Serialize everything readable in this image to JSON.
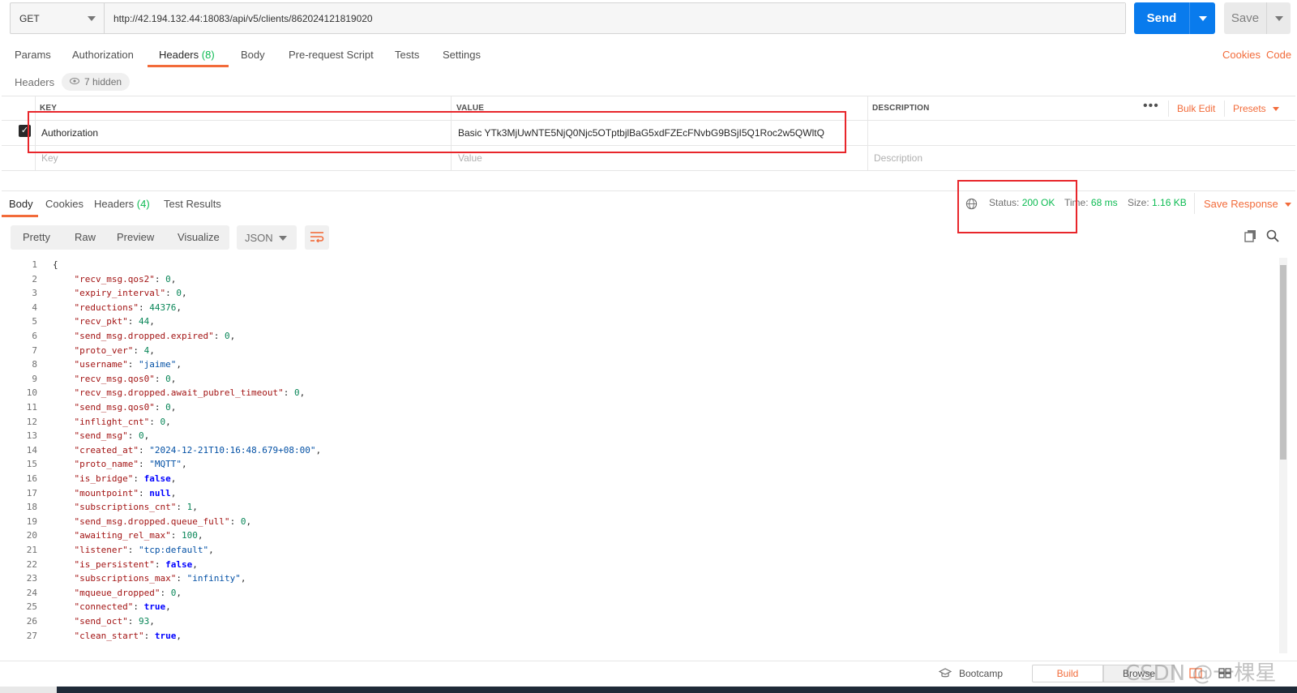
{
  "request": {
    "method": "GET",
    "url": "http://42.194.132.44:18083/api/v5/clients/862024121819020",
    "send_label": "Send",
    "save_label": "Save"
  },
  "request_tabs": [
    {
      "label": "Params"
    },
    {
      "label": "Authorization"
    },
    {
      "label": "Headers",
      "count": "(8)"
    },
    {
      "label": "Body"
    },
    {
      "label": "Pre-request Script"
    },
    {
      "label": "Tests"
    },
    {
      "label": "Settings"
    }
  ],
  "right_links": {
    "cookies": "Cookies",
    "code": "Code"
  },
  "headers_section": {
    "title": "Headers",
    "hidden_badge": "7 hidden",
    "columns": {
      "key": "KEY",
      "value": "VALUE",
      "description": "DESCRIPTION"
    },
    "actions": {
      "bulk_edit": "Bulk Edit",
      "presets": "Presets"
    },
    "rows": [
      {
        "key": "Authorization",
        "value": "Basic YTk3MjUwNTE5NjQ0Njc5OTptbjlBaG5xdFZEcFNvbG9BSjI5Q1Roc2w5QWltQ",
        "description": ""
      }
    ],
    "placeholder": {
      "key": "Key",
      "value": "Value",
      "description": "Description"
    }
  },
  "response_tabs": [
    {
      "label": "Body"
    },
    {
      "label": "Cookies"
    },
    {
      "label": "Headers",
      "count": "(4)"
    },
    {
      "label": "Test Results"
    }
  ],
  "response_status": {
    "status_label": "Status:",
    "status_value": "200 OK",
    "time_label": "Time:",
    "time_value": "68 ms",
    "size_label": "Size:",
    "size_value": "1.16 KB",
    "save_response": "Save Response"
  },
  "view_modes": [
    "Pretty",
    "Raw",
    "Preview",
    "Visualize"
  ],
  "format": "JSON",
  "json_lines": [
    {
      "n": "1",
      "k": "",
      "v": "",
      "t": "open"
    },
    {
      "n": "2",
      "k": "\"recv_msg.qos2\"",
      "v": "0",
      "t": "num"
    },
    {
      "n": "3",
      "k": "\"expiry_interval\"",
      "v": "0",
      "t": "num"
    },
    {
      "n": "4",
      "k": "\"reductions\"",
      "v": "44376",
      "t": "num"
    },
    {
      "n": "5",
      "k": "\"recv_pkt\"",
      "v": "44",
      "t": "num"
    },
    {
      "n": "6",
      "k": "\"send_msg.dropped.expired\"",
      "v": "0",
      "t": "num"
    },
    {
      "n": "7",
      "k": "\"proto_ver\"",
      "v": "4",
      "t": "num"
    },
    {
      "n": "8",
      "k": "\"username\"",
      "v": "\"jaime\"",
      "t": "str"
    },
    {
      "n": "9",
      "k": "\"recv_msg.qos0\"",
      "v": "0",
      "t": "num"
    },
    {
      "n": "10",
      "k": "\"recv_msg.dropped.await_pubrel_timeout\"",
      "v": "0",
      "t": "num"
    },
    {
      "n": "11",
      "k": "\"send_msg.qos0\"",
      "v": "0",
      "t": "num"
    },
    {
      "n": "12",
      "k": "\"inflight_cnt\"",
      "v": "0",
      "t": "num"
    },
    {
      "n": "13",
      "k": "\"send_msg\"",
      "v": "0",
      "t": "num"
    },
    {
      "n": "14",
      "k": "\"created_at\"",
      "v": "\"2024-12-21T10:16:48.679+08:00\"",
      "t": "str"
    },
    {
      "n": "15",
      "k": "\"proto_name\"",
      "v": "\"MQTT\"",
      "t": "str"
    },
    {
      "n": "16",
      "k": "\"is_bridge\"",
      "v": "false",
      "t": "kw"
    },
    {
      "n": "17",
      "k": "\"mountpoint\"",
      "v": "null",
      "t": "kw"
    },
    {
      "n": "18",
      "k": "\"subscriptions_cnt\"",
      "v": "1",
      "t": "num"
    },
    {
      "n": "19",
      "k": "\"send_msg.dropped.queue_full\"",
      "v": "0",
      "t": "num"
    },
    {
      "n": "20",
      "k": "\"awaiting_rel_max\"",
      "v": "100",
      "t": "num"
    },
    {
      "n": "21",
      "k": "\"listener\"",
      "v": "\"tcp:default\"",
      "t": "str"
    },
    {
      "n": "22",
      "k": "\"is_persistent\"",
      "v": "false",
      "t": "kw"
    },
    {
      "n": "23",
      "k": "\"subscriptions_max\"",
      "v": "\"infinity\"",
      "t": "str"
    },
    {
      "n": "24",
      "k": "\"mqueue_dropped\"",
      "v": "0",
      "t": "num"
    },
    {
      "n": "25",
      "k": "\"connected\"",
      "v": "true",
      "t": "kw"
    },
    {
      "n": "26",
      "k": "\"send_oct\"",
      "v": "93",
      "t": "num"
    },
    {
      "n": "27",
      "k": "\"clean_start\"",
      "v": "true",
      "t": "kw"
    }
  ],
  "status_bar": {
    "bootcamp": "Bootcamp",
    "build": "Build",
    "browse": "Browse"
  },
  "watermark": "CSDN @一棵星",
  "colors": {
    "accent": "#f26b3a",
    "send": "#097bed",
    "success": "#0cbb52",
    "highlight_box": "#e8262b"
  }
}
